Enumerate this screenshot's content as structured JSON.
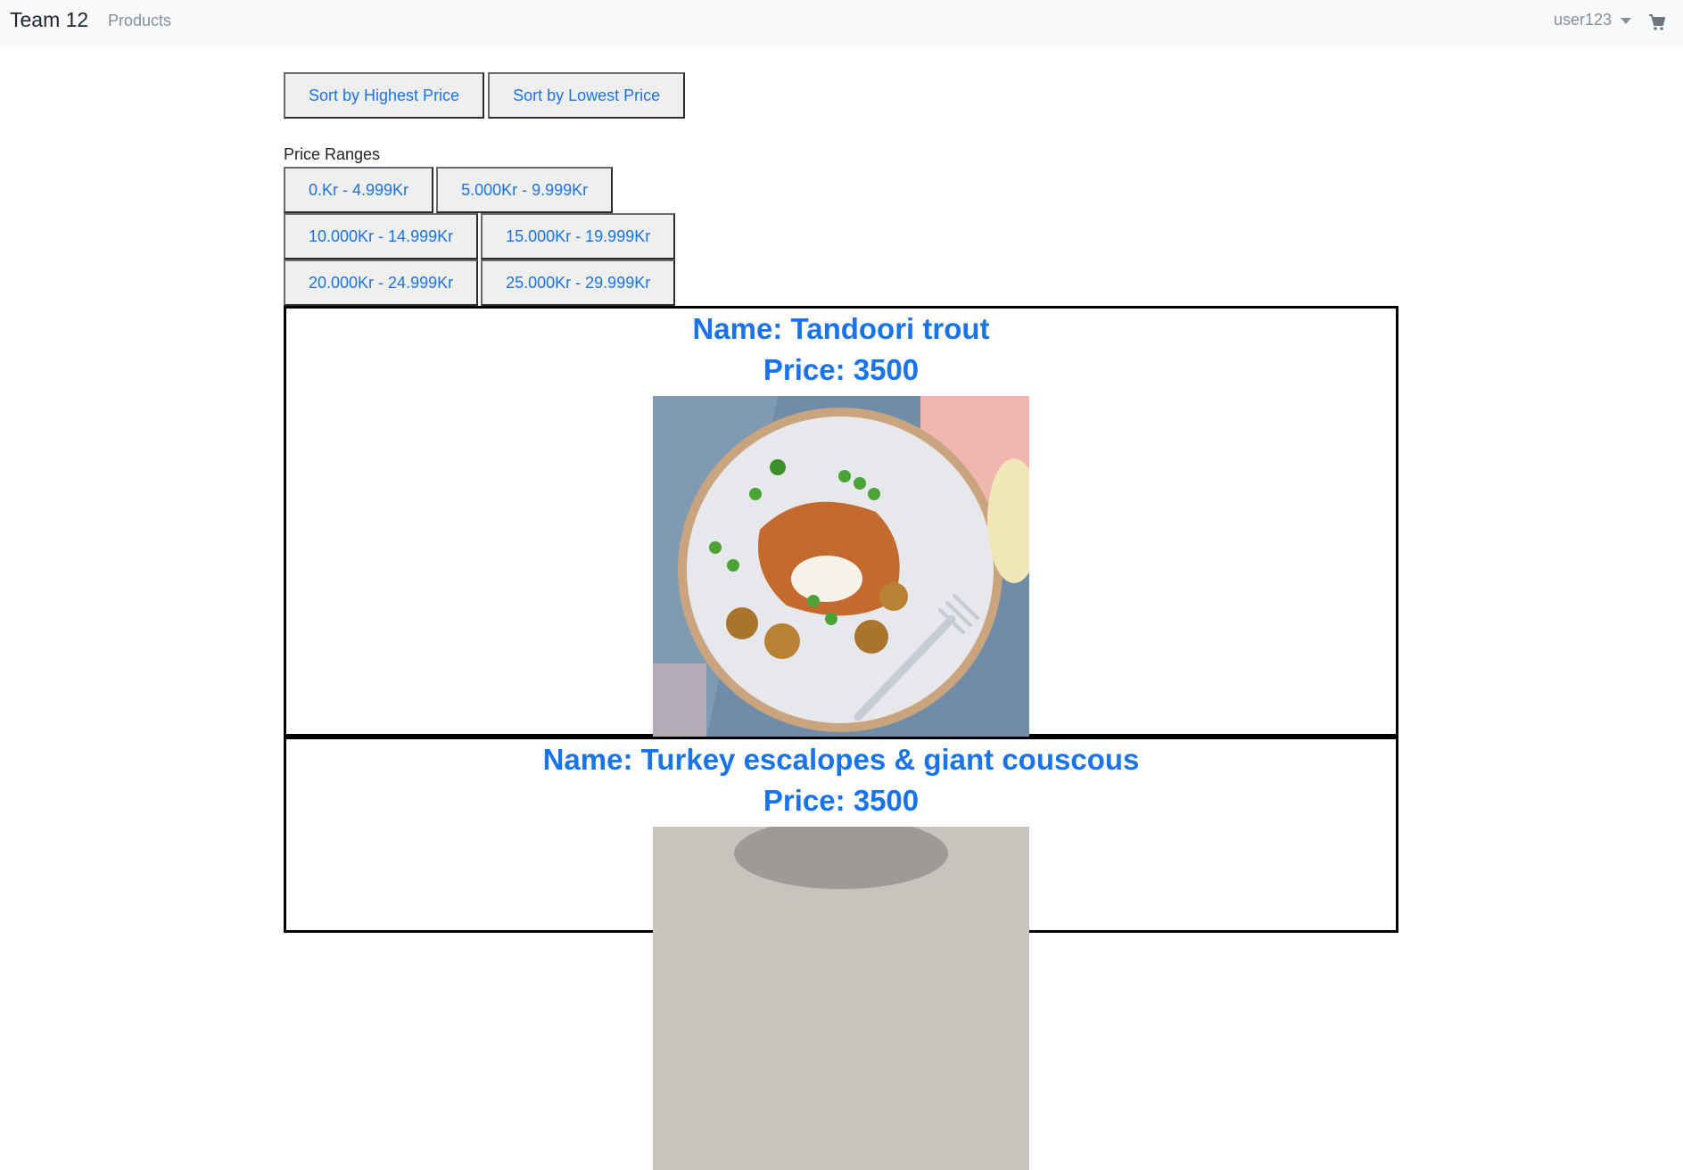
{
  "navbar": {
    "brand": "Team 12",
    "products_link": "Products",
    "user": "user123",
    "cart_icon": "cart-icon"
  },
  "sort": {
    "highest": "Sort by Highest Price",
    "lowest": "Sort by Lowest Price"
  },
  "price_ranges": {
    "label": "Price Ranges",
    "ranges": [
      "0.Kr - 4.999Kr",
      "5.000Kr - 9.999Kr",
      "10.000Kr - 14.999Kr",
      "15.000Kr - 19.999Kr",
      "20.000Kr - 24.999Kr",
      "25.000Kr - 29.999Kr"
    ]
  },
  "products": [
    {
      "name": "Name: Tandoori trout",
      "price": "Price: 3500"
    },
    {
      "name": "Name: Turkey escalopes & giant couscous",
      "price": "Price: 3500"
    }
  ],
  "colors": {
    "link": "#1a73e8",
    "navbar_bg": "#f8f9fa",
    "button_bg": "#efefef"
  }
}
